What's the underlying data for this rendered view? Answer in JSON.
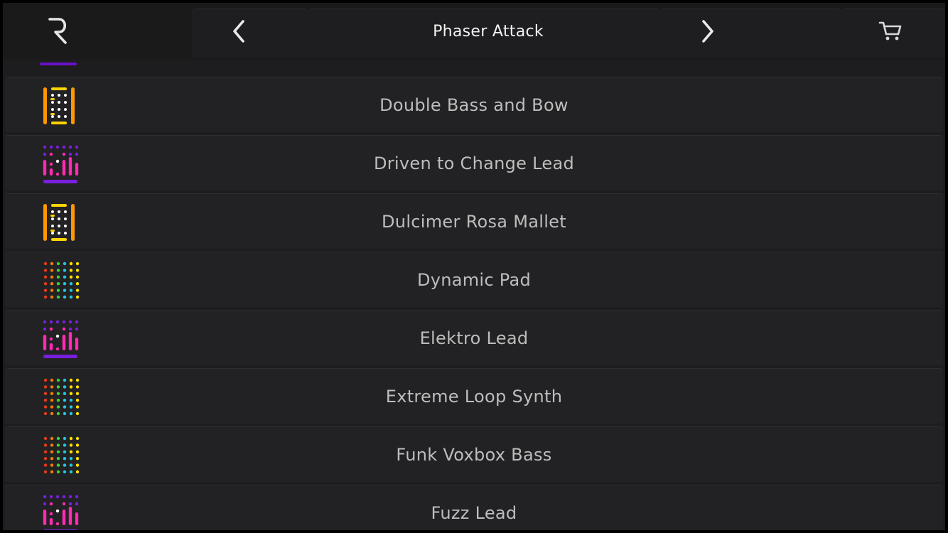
{
  "header": {
    "title": "Phaser Attack",
    "logo_icon": "r-logo-icon",
    "back_icon": "chevron-left-icon",
    "forward_icon": "chevron-right-icon",
    "cart_icon": "cart-icon"
  },
  "colors": {
    "background": "#1d1d1f",
    "row": "#222224",
    "label": "#bdbdbd",
    "title": "#f2f2f2",
    "yellow": "#ffd400",
    "orange": "#ff9800",
    "magenta": "#ff2bb0",
    "purple": "#7a1fe0"
  },
  "presets": [
    {
      "label": "Double Bass and Bow",
      "icon": "keys-icon"
    },
    {
      "label": "Driven to Change Lead",
      "icon": "synth-icon"
    },
    {
      "label": "Dulcimer Rosa Mallet",
      "icon": "keys-icon"
    },
    {
      "label": "Dynamic Pad",
      "icon": "grid-icon"
    },
    {
      "label": "Elektro Lead",
      "icon": "synth-icon"
    },
    {
      "label": "Extreme Loop Synth",
      "icon": "grid-icon"
    },
    {
      "label": "Funk Voxbox Bass",
      "icon": "grid-icon"
    },
    {
      "label": "Fuzz Lead",
      "icon": "synth-icon"
    }
  ]
}
